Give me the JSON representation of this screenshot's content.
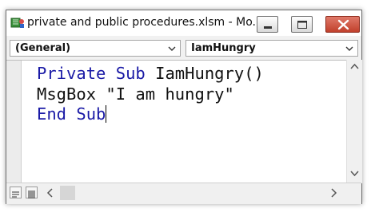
{
  "window": {
    "title": "private and public procedures.xlsm - Mo...",
    "icons": {
      "app": "vba-module-icon",
      "minimize": "minimize-icon",
      "maximize": "maximize-icon",
      "close": "close-icon"
    }
  },
  "combos": {
    "object": {
      "value": "(General)"
    },
    "procedure": {
      "value": "IamHungry"
    }
  },
  "code": {
    "line1_kw1": "Private",
    "line1_kw2": "Sub",
    "line1_rest": "IamHungry()",
    "line2": "MsgBox \"I am hungry\"",
    "line3_kw": "End Sub"
  },
  "colors": {
    "keyword": "#1a1aa6",
    "close_button": "#c74a37"
  }
}
